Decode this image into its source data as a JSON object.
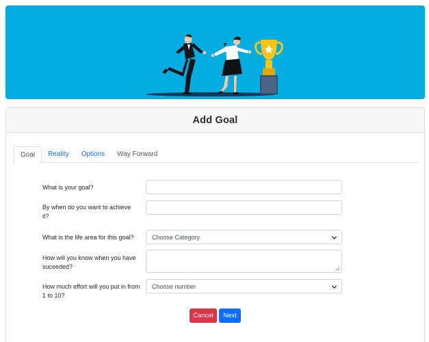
{
  "hero": {
    "background": "#02ade2",
    "illustration": "businesspeople-racing-to-trophy"
  },
  "card": {
    "title": "Add Goal"
  },
  "tabs": [
    {
      "label": "Goal",
      "active": true
    },
    {
      "label": "Reality",
      "active": false
    },
    {
      "label": "Options",
      "active": false
    },
    {
      "label": "Way Forward",
      "active": false
    }
  ],
  "form": {
    "goal": {
      "label": "What is your goal?",
      "value": "",
      "placeholder": ""
    },
    "deadline": {
      "label": "By when do you want to achieve it?",
      "value": "",
      "placeholder": ""
    },
    "life_area": {
      "label": "What is the life area for this goal?",
      "selected": "Choose Category"
    },
    "success": {
      "label": "How will you know when you have suceeded?",
      "value": ""
    },
    "effort": {
      "label": "How much effort will you put in from 1 to 10?",
      "selected": "Choose number"
    }
  },
  "buttons": {
    "cancel": "Cancel",
    "next": "Next"
  },
  "colors": {
    "cancel": "#dc3545",
    "next": "#0d6efd",
    "trophy": "#f5c518"
  }
}
